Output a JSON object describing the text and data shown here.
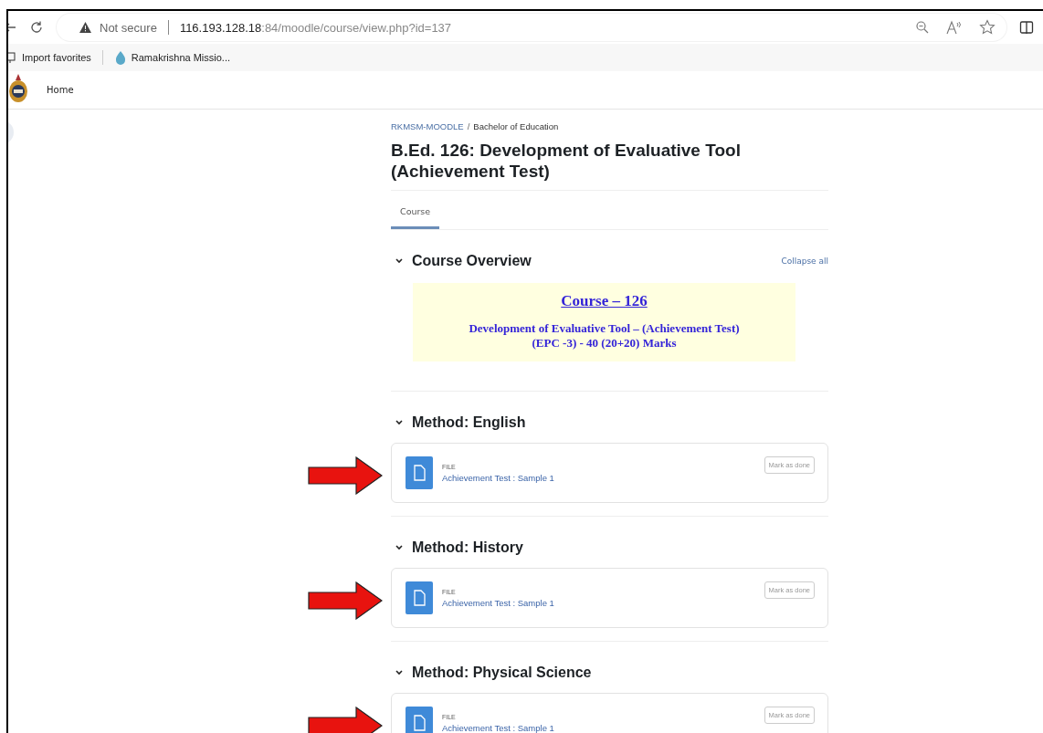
{
  "browser": {
    "security": "Not secure",
    "url_host": "116.193.128.18",
    "url_rest": ":84/moodle/course/view.php?id=137"
  },
  "bookmarks": [
    {
      "label": "Import favorites",
      "kind": "import"
    },
    {
      "label": "Ramakrishna Missio...",
      "kind": "site"
    }
  ],
  "nav": {
    "items": [
      {
        "label": "Home"
      }
    ]
  },
  "breadcrumb": [
    "RKMSM-MOODLE",
    "Bachelor of Education"
  ],
  "breadcrumb_separator": "/",
  "title": "B.Ed. 126: Development of Evaluative Tool (Achievement Test)",
  "tabs": [
    {
      "label": "Course",
      "selected": true
    }
  ],
  "collapse_all": "Collapse all",
  "sections": [
    {
      "title": "Course Overview",
      "expanded": true,
      "kind": "overview",
      "banner": {
        "heading": "Course – 126",
        "lines": [
          "Development of Evaluative Tool – (Achievement Test)",
          "(EPC -3) - 40 (20+20) Marks"
        ]
      }
    },
    {
      "title": "Method: English",
      "expanded": true,
      "kind": "activities",
      "activities": [
        {
          "type": "FILE",
          "name": "Achievement Test : Sample 1",
          "button": "Mark as done",
          "highlighted": true
        }
      ]
    },
    {
      "title": "Method: History",
      "expanded": true,
      "kind": "activities",
      "activities": [
        {
          "type": "FILE",
          "name": "Achievement Test : Sample 1",
          "button": "Mark as done",
          "highlighted": true
        }
      ]
    },
    {
      "title": "Method: Physical Science",
      "expanded": true,
      "kind": "activities",
      "activities": [
        {
          "type": "FILE",
          "name": "Achievement Test : Sample 1",
          "button": "Mark as done",
          "highlighted": true
        }
      ]
    }
  ]
}
